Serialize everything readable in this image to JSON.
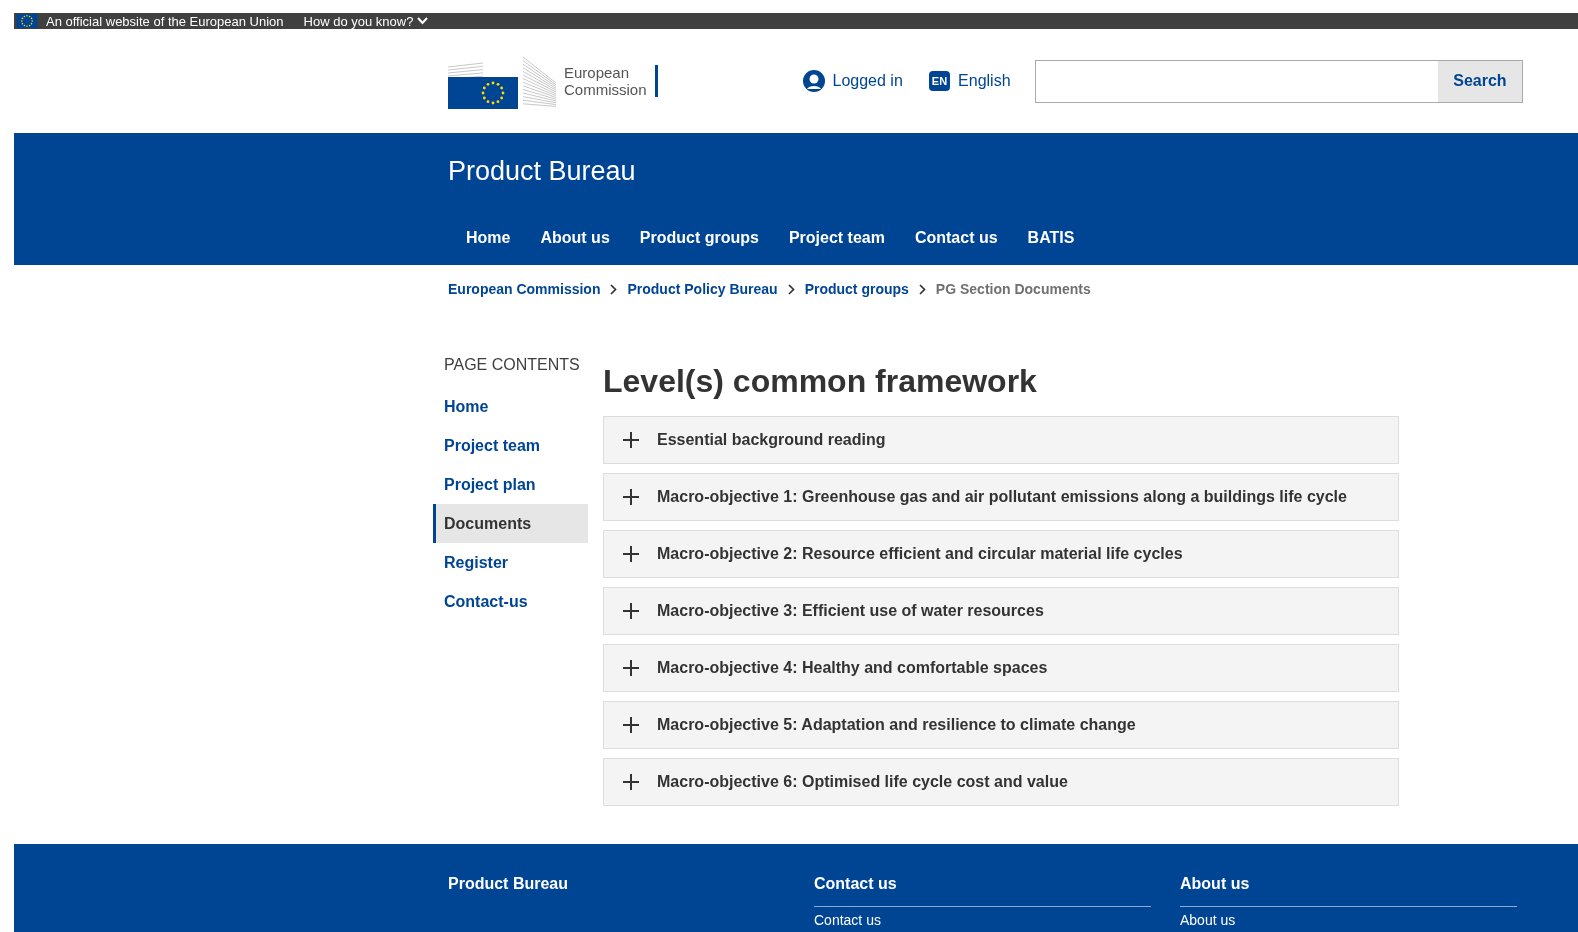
{
  "top_bar": {
    "official_text": "An official website of the European Union",
    "how_link": "How do you know?"
  },
  "header": {
    "logo_text": [
      "European",
      "Commission"
    ],
    "logged_in": "Logged in",
    "language_code": "EN",
    "language": "English",
    "search": {
      "button": "Search"
    }
  },
  "site_title": "Product Bureau",
  "nav": [
    "Home",
    "About us",
    "Product groups",
    "Project team",
    "Contact us",
    "BATIS"
  ],
  "breadcrumb": [
    {
      "label": "European Commission",
      "link": true
    },
    {
      "label": "Product Policy Bureau",
      "link": true
    },
    {
      "label": "Product groups",
      "link": true
    },
    {
      "label": "PG Section Documents",
      "link": false
    }
  ],
  "sidebar": {
    "title": "PAGE CONTENTS",
    "items": [
      {
        "label": "Home",
        "selected": false
      },
      {
        "label": "Project team",
        "selected": false
      },
      {
        "label": "Project plan",
        "selected": false
      },
      {
        "label": "Documents",
        "selected": true
      },
      {
        "label": "Register",
        "selected": false
      },
      {
        "label": "Contact-us",
        "selected": false
      }
    ]
  },
  "page_title": "Level(s) common framework",
  "accordion": [
    {
      "label": "Essential background reading",
      "expanded": false
    },
    {
      "label": "Macro-objective 1: Greenhouse gas and air pollutant emissions along a buildings life cycle",
      "expanded": false
    },
    {
      "label": "Macro-objective 2: Resource efficient and circular material life cycles",
      "expanded": false
    },
    {
      "label": "Macro-objective 3: Efficient use of water resources",
      "expanded": false
    },
    {
      "label": "Macro-objective 4: Healthy and comfortable spaces",
      "expanded": false
    },
    {
      "label": "Macro-objective 5: Adaptation and resilience to climate change",
      "expanded": false
    },
    {
      "label": "Macro-objective 6: Optimised life cycle cost and value",
      "expanded": false
    }
  ],
  "footer": {
    "brand": "Product Bureau",
    "columns": [
      {
        "title": "Contact us",
        "links": [
          "Contact us"
        ]
      },
      {
        "title": "About us",
        "links": [
          "About us"
        ]
      }
    ]
  }
}
